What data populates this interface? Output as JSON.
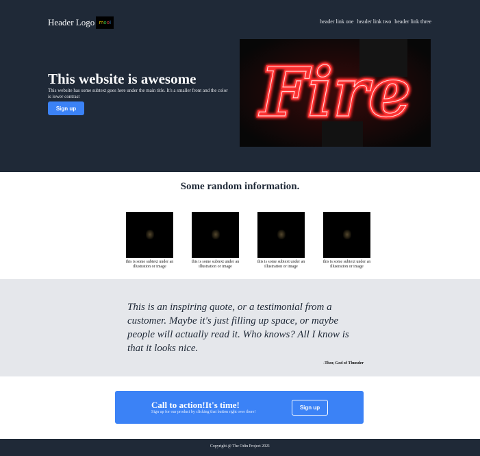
{
  "header": {
    "logo_text": "Header Logo",
    "logo_badge_letters": [
      "m",
      "o",
      "o",
      "i"
    ],
    "nav_links": [
      "header link one",
      "header link two",
      "header link three"
    ]
  },
  "hero": {
    "title": "This website is awesome",
    "subtitle": "This website has some subtext goes here under the main title. It's a smaller front and the color is lower contrast",
    "button_label": "Sign up",
    "image_word": "Fire"
  },
  "info": {
    "title": "Some random information.",
    "cards": [
      {
        "caption": "this is some subtext under an illustration or image"
      },
      {
        "caption": "this is some subtext under an illustration or image"
      },
      {
        "caption": "this is some subtext under an illustration or image"
      },
      {
        "caption": "this is some subtext under an illustration or image"
      }
    ]
  },
  "quote": {
    "text": "This is an inspiring quote, or a testimonial from a customer. Maybe it's just filling up space, or maybe people will actually read it. Who knows? All I know is that it looks nice.",
    "author": "-Thor, God of Thunder"
  },
  "cta": {
    "title": "Call to action!It's time!",
    "subtitle": "Sign up for our product by clicking that button right over there!",
    "button_label": "Sign up"
  },
  "footer": {
    "copyright": "Copyright @ The Odin Project 2021"
  },
  "colors": {
    "dark": "#1f2937",
    "accent": "#3b82f6",
    "quote_bg": "#e5e7eb",
    "neon": "#ff2a2a"
  }
}
